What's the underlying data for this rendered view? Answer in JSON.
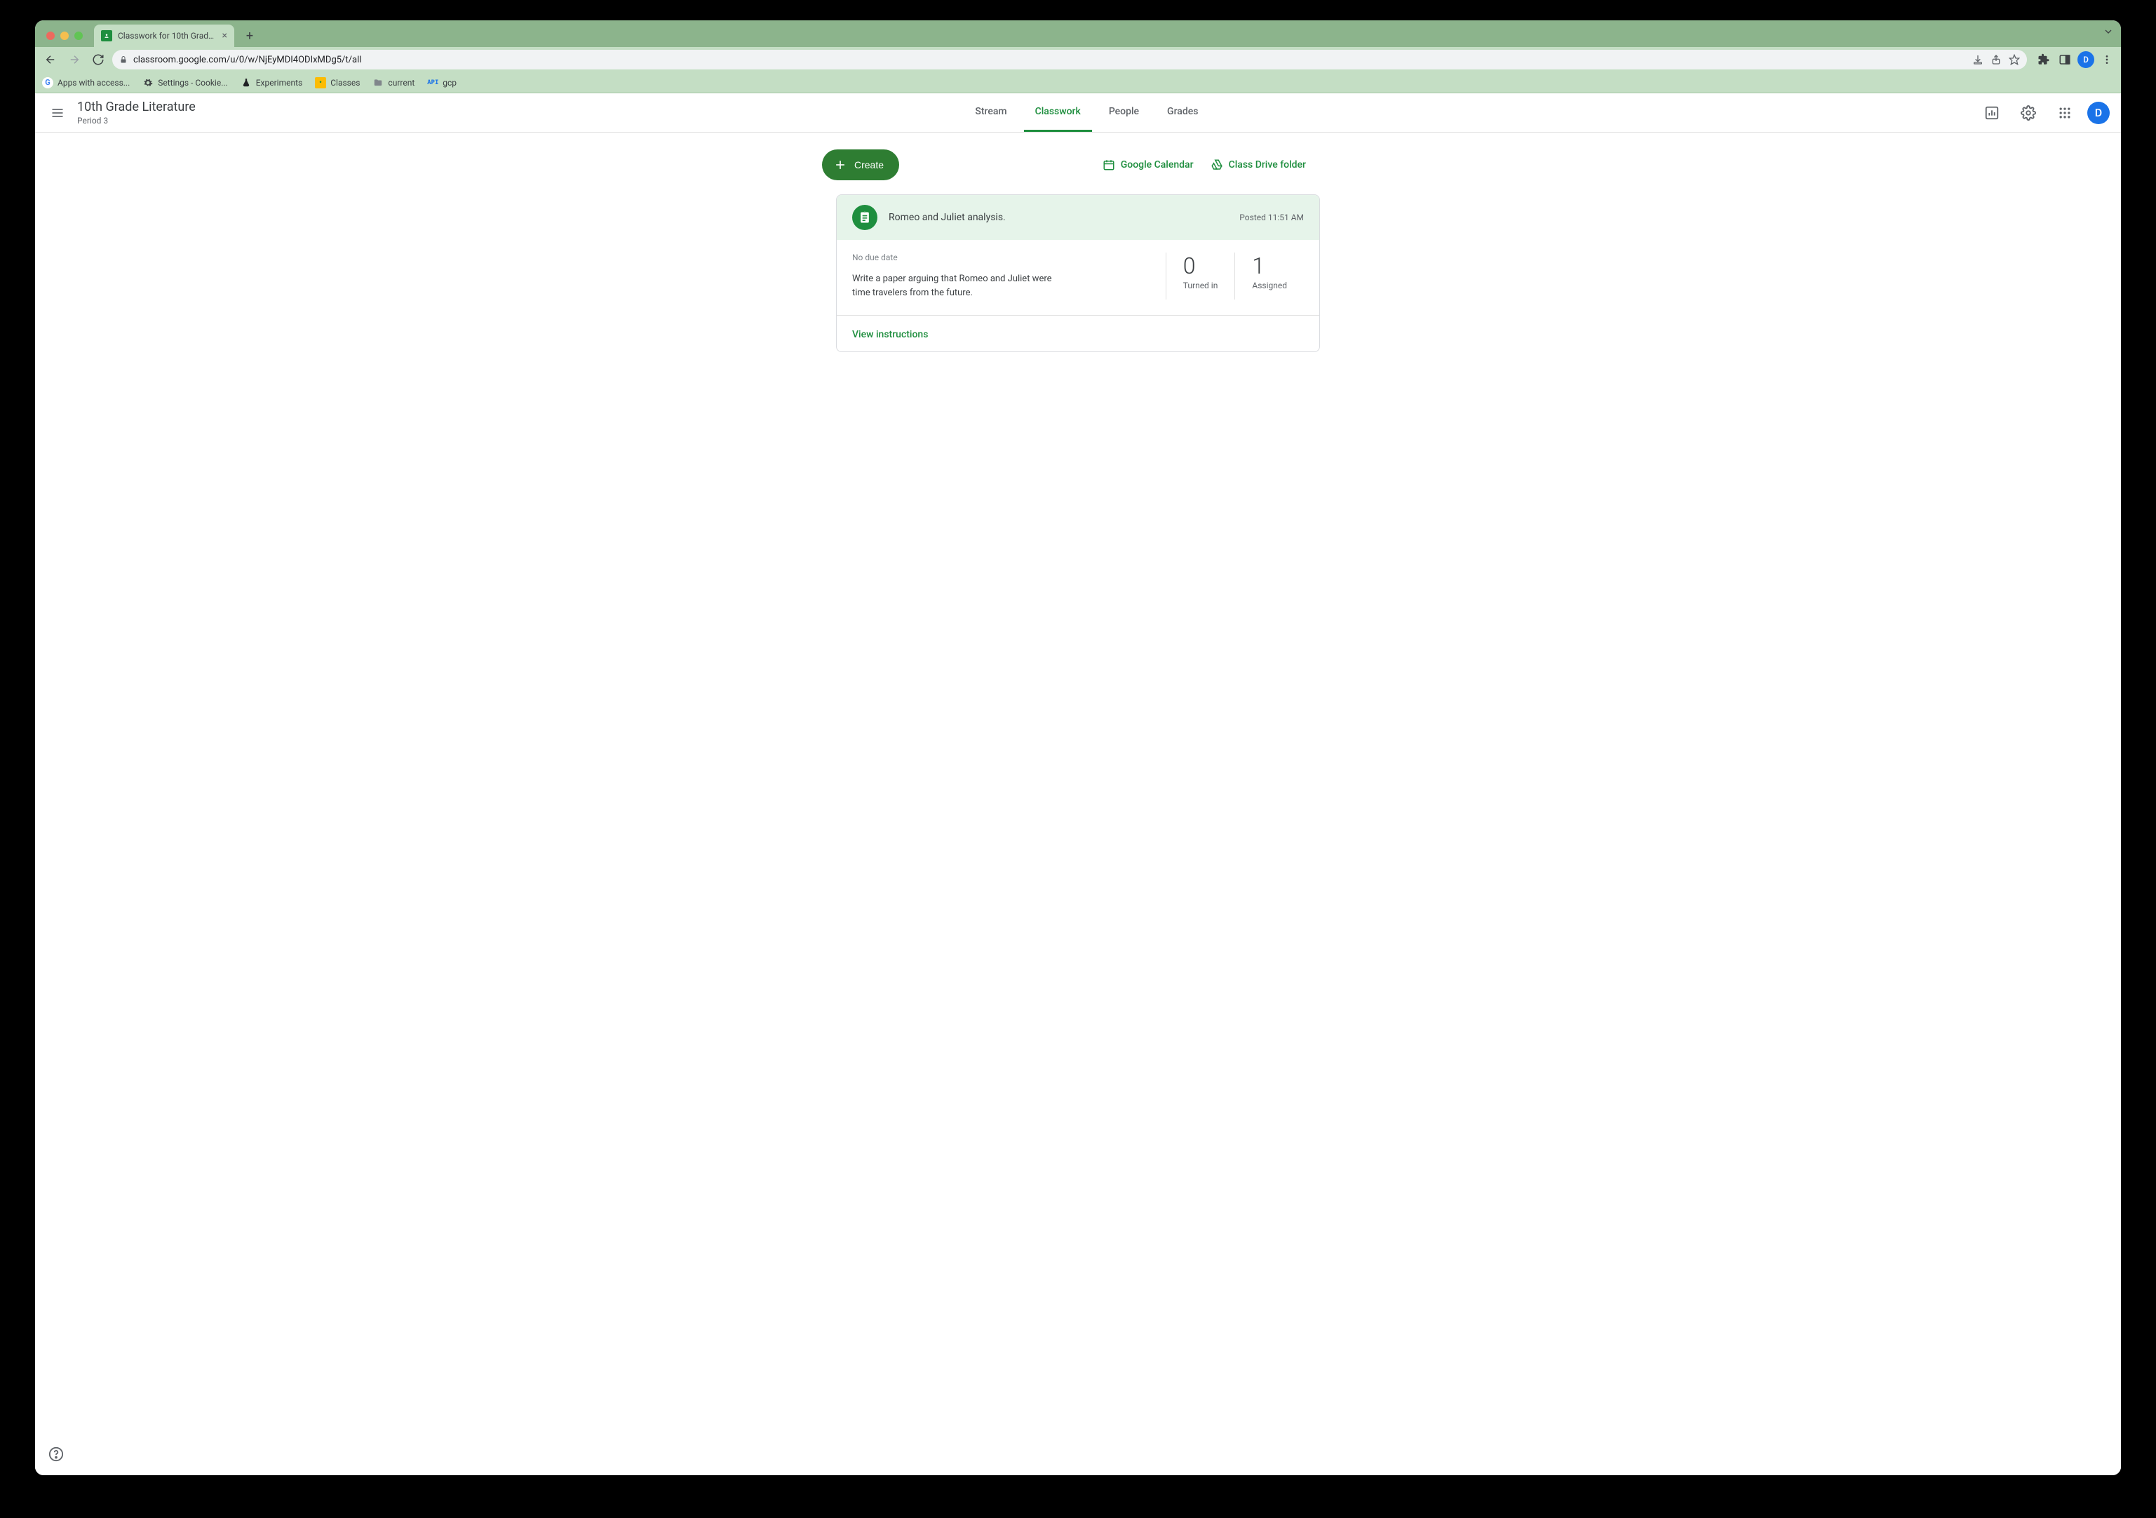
{
  "browser": {
    "tab_title": "Classwork for 10th Grade Liter...",
    "url": "classroom.google.com/u/0/w/NjEyMDI4ODIxMDg5/t/all",
    "avatar_letter": "D",
    "bookmarks": [
      {
        "label": "Apps with access..."
      },
      {
        "label": "Settings - Cookie..."
      },
      {
        "label": "Experiments"
      },
      {
        "label": "Classes"
      },
      {
        "label": "current"
      },
      {
        "label": "gcp"
      }
    ]
  },
  "header": {
    "class_name": "10th Grade Literature",
    "section": "Period 3",
    "tabs": [
      "Stream",
      "Classwork",
      "People",
      "Grades"
    ],
    "active_tab": "Classwork",
    "avatar_letter": "D"
  },
  "actions": {
    "create_label": "Create",
    "calendar_label": "Google Calendar",
    "drive_label": "Class Drive folder"
  },
  "assignment": {
    "title": "Romeo and Juliet analysis.",
    "posted": "Posted 11:51 AM",
    "due": "No due date",
    "description": "Write a paper arguing that Romeo and Juliet were time travelers from the future.",
    "turned_in_count": "0",
    "turned_in_label": "Turned in",
    "assigned_count": "1",
    "assigned_label": "Assigned",
    "view_label": "View instructions"
  }
}
